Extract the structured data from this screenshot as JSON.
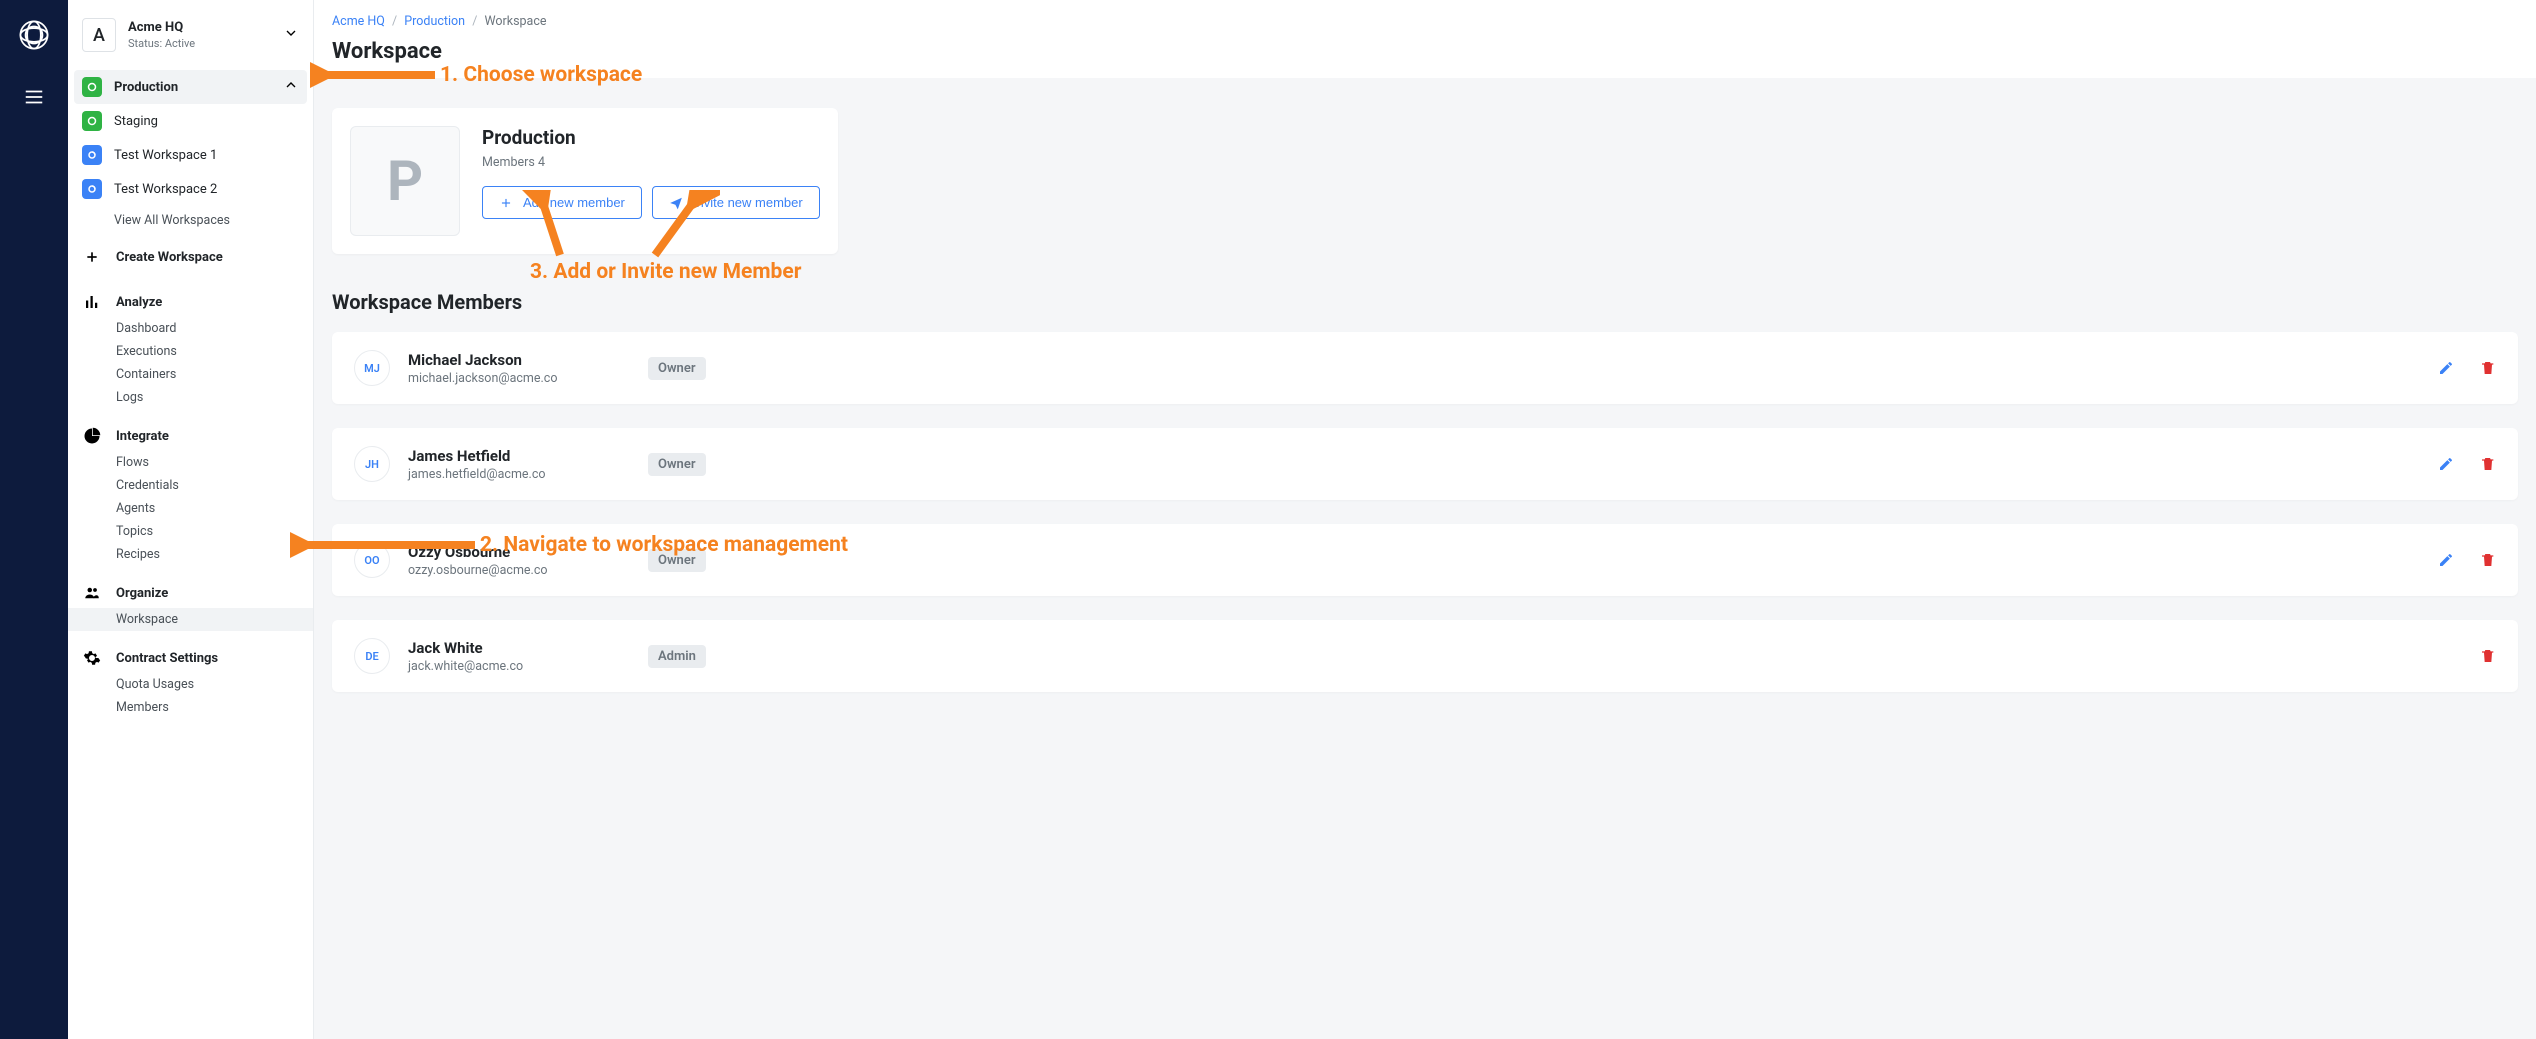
{
  "org": {
    "name": "Acme HQ",
    "status": "Status: Active",
    "avatar": "A"
  },
  "workspaces": {
    "active": "Production",
    "list": [
      "Production",
      "Staging",
      "Test Workspace 1",
      "Test Workspace 2"
    ],
    "view_all": "View All Workspaces"
  },
  "create_workspace": "Create Workspace",
  "nav": {
    "analyze": {
      "heading": "Analyze",
      "items": [
        "Dashboard",
        "Executions",
        "Containers",
        "Logs"
      ]
    },
    "integrate": {
      "heading": "Integrate",
      "items": [
        "Flows",
        "Credentials",
        "Agents",
        "Topics",
        "Recipes"
      ]
    },
    "organize": {
      "heading": "Organize",
      "items": [
        "Workspace"
      ]
    },
    "contract": {
      "heading": "Contract Settings",
      "items": [
        "Quota Usages",
        "Members"
      ]
    }
  },
  "breadcrumb": {
    "a": "Acme HQ",
    "b": "Production",
    "c": "Workspace"
  },
  "page_title": "Workspace",
  "workspace_card": {
    "avatar": "P",
    "title": "Production",
    "members_label": "Members 4",
    "add_btn": "Add new member",
    "invite_btn": "Invite new member"
  },
  "members_title": "Workspace Members",
  "members": [
    {
      "initials": "MJ",
      "name": "Michael Jackson",
      "email": "michael.jackson@acme.co",
      "role": "Owner",
      "editable": true
    },
    {
      "initials": "JH",
      "name": "James Hetfield",
      "email": "james.hetfield@acme.co",
      "role": "Owner",
      "editable": true
    },
    {
      "initials": "OO",
      "name": "Ozzy Osbourne",
      "email": "ozzy.osbourne@acme.co",
      "role": "Owner",
      "editable": true
    },
    {
      "initials": "DE",
      "name": "Jack White",
      "email": "jack.white@acme.co",
      "role": "Admin",
      "editable": false
    }
  ],
  "annotations": {
    "step1": "1. Choose workspace",
    "step2": "2. Navigate to workspace management",
    "step3": "3. Add or Invite new Member"
  }
}
